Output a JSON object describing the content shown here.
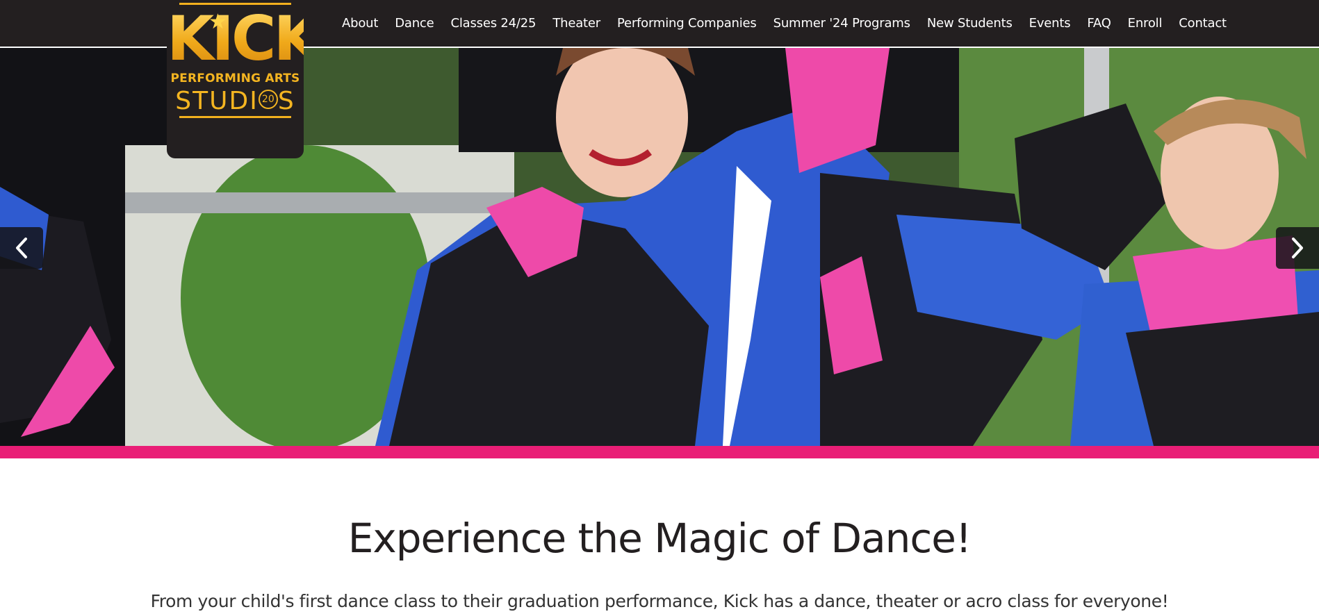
{
  "brand": {
    "logo_word": "KICK",
    "logo_line1": "PERFORMING ARTS",
    "logo_line2": "STUDI",
    "logo_line2_end": "S",
    "logo_badge": "20",
    "gold": "#f4b521"
  },
  "nav": {
    "items": [
      {
        "label": "About"
      },
      {
        "label": "Dance"
      },
      {
        "label": "Classes 24/25"
      },
      {
        "label": "Theater"
      },
      {
        "label": "Performing Companies"
      },
      {
        "label": "Summer '24 Programs"
      },
      {
        "label": "New Students"
      },
      {
        "label": "Events"
      },
      {
        "label": "FAQ"
      },
      {
        "label": "Enroll"
      },
      {
        "label": "Contact"
      }
    ]
  },
  "carousel": {
    "prev_icon": "chevron-left-icon",
    "next_icon": "chevron-right-icon"
  },
  "main": {
    "headline": "Experience the Magic of Dance!",
    "intro": "From your child's first dance class to their graduation performance, Kick has a dance, theater or acro class for everyone!"
  },
  "colors": {
    "topbar": "#231f20",
    "accent": "#e91e76",
    "text": "#231f20"
  }
}
